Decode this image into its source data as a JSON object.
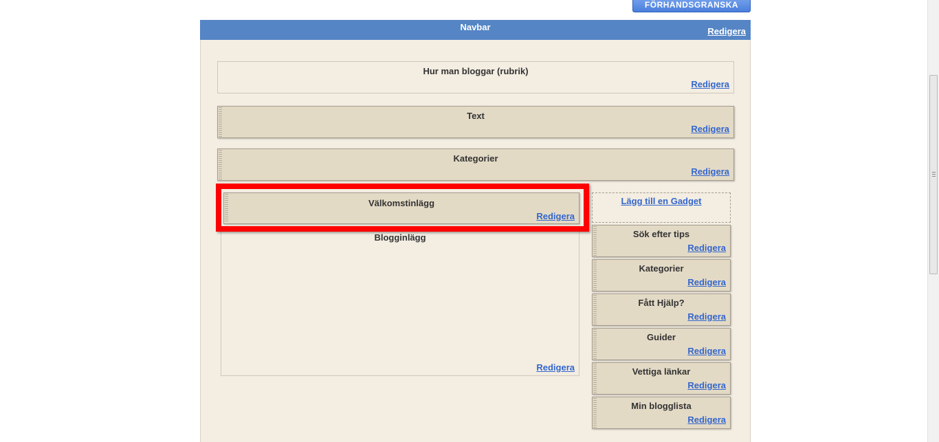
{
  "toolbar": {
    "preview_label": "FÖRHANDSGRANSKA"
  },
  "navbar": {
    "title": "Navbar",
    "edit_label": "Redigera"
  },
  "header_gadget": {
    "title": "Hur man bloggar (rubrik)",
    "edit_label": "Redigera"
  },
  "main_gadgets": [
    {
      "title": "Text",
      "edit_label": "Redigera"
    },
    {
      "title": "Kategorier",
      "edit_label": "Redigera"
    },
    {
      "title": "Välkomstinlägg",
      "edit_label": "Redigera"
    }
  ],
  "blog_posts": {
    "title": "Blogginlägg",
    "edit_label": "Redigera"
  },
  "sidebar": {
    "add_gadget_label": "Lägg till en Gadget",
    "gadgets": [
      {
        "title": "Sök efter tips",
        "edit_label": "Redigera"
      },
      {
        "title": "Kategorier",
        "edit_label": "Redigera"
      },
      {
        "title": "Fått Hjälp?",
        "edit_label": "Redigera"
      },
      {
        "title": "Guider",
        "edit_label": "Redigera"
      },
      {
        "title": "Vettiga länkar",
        "edit_label": "Redigera"
      },
      {
        "title": "Min blogglista",
        "edit_label": "Redigera"
      }
    ]
  },
  "colors": {
    "link": "#3366cc",
    "navbar": "#5585c5",
    "canvas": "#f3ede2",
    "gadget": "#e3dac6",
    "highlight": "#ff0000"
  }
}
